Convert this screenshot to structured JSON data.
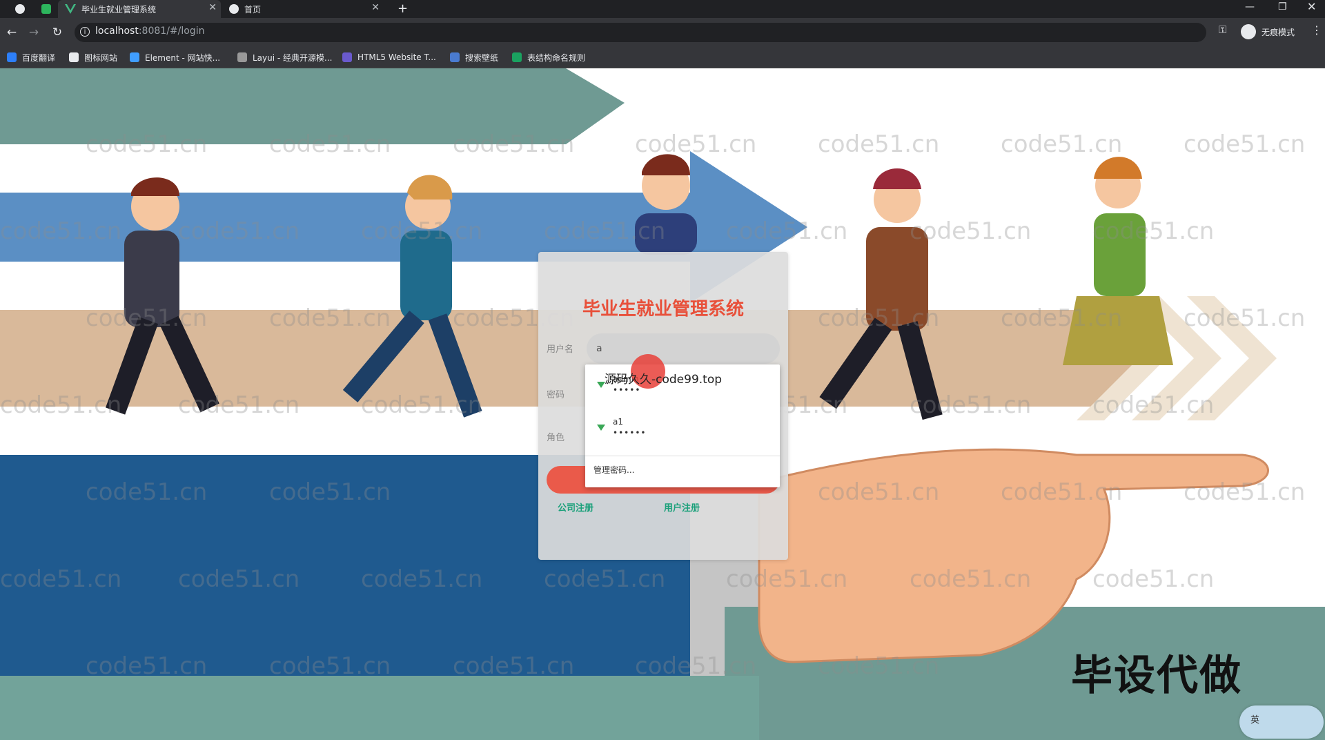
{
  "browser": {
    "tabs": [
      {
        "label": "毕业生就业管理系统",
        "active": true
      },
      {
        "label": "首页",
        "active": false
      }
    ],
    "new_tab_symbol": "+",
    "url_host": "localhost",
    "url_rest": ":8081/#/login",
    "profile_label": "无痕模式",
    "bookmarks": [
      {
        "label": "百度翻译",
        "color": "#2d7ff9"
      },
      {
        "label": "图标网站",
        "color": "#444444"
      },
      {
        "label": "Element - 网站快...",
        "color": "#409eff"
      },
      {
        "label": "Layui - 经典开源模...",
        "color": "#666666"
      },
      {
        "label": "HTML5 Website T...",
        "color": "#6a5acd"
      },
      {
        "label": "搜索壁纸",
        "color": "#4a7bd0"
      },
      {
        "label": "表结构命名规则",
        "color": "#1aa260"
      }
    ]
  },
  "watermark_text": "code51.cn",
  "login": {
    "title": "毕业生就业管理系统",
    "username_label": "用户名",
    "username_value": "a",
    "password_label": "密码",
    "role_label": "角色",
    "company_register": "公司注册",
    "user_register": "用户注册"
  },
  "autofill": {
    "items": [
      {
        "user": "admin",
        "pass": "•••••"
      },
      {
        "user": "a1",
        "pass": "••••••"
      }
    ],
    "manage_label": "管理密码..."
  },
  "overlay_text": "源码久久-code99.top",
  "promo_text": "毕设代做",
  "ime_label": "英",
  "colors": {
    "title": "#e8503a",
    "button": "#ea5a4a",
    "link": "#1aa07a",
    "key_icon": "#3aa757"
  }
}
